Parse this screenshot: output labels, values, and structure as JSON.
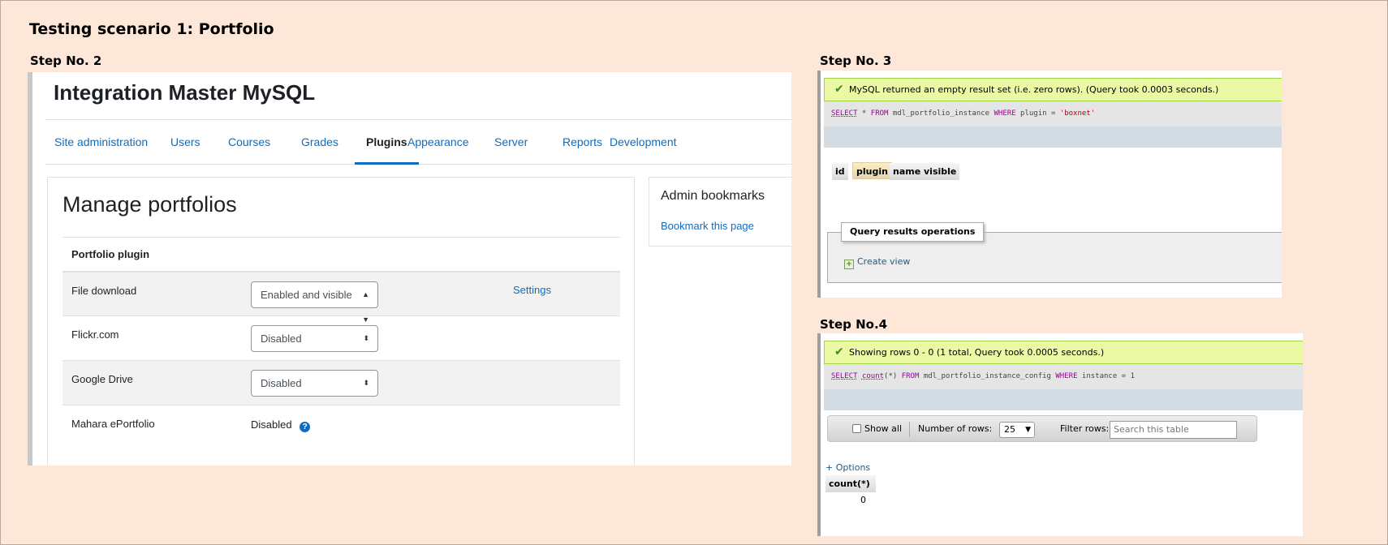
{
  "doc": {
    "title": "Testing scenario 1: Portfolio",
    "step2_label": "Step No. 2",
    "step3_label": "Step No. 3",
    "step4_label": "Step No.4"
  },
  "moodle": {
    "site_title": "Integration Master MySQL",
    "nav": [
      {
        "label": "Site administration",
        "active": false
      },
      {
        "label": "Users",
        "active": false
      },
      {
        "label": "Courses",
        "active": false
      },
      {
        "label": "Grades",
        "active": false
      },
      {
        "label": "Plugins",
        "active": true
      },
      {
        "label": "Appearance",
        "active": false
      },
      {
        "label": "Server",
        "active": false
      },
      {
        "label": "Reports",
        "active": false
      },
      {
        "label": "Development",
        "active": false
      }
    ],
    "heading": "Manage portfolios",
    "table_header": "Portfolio plugin",
    "rows": [
      {
        "name": "File download",
        "state": "Enabled and visible",
        "settings": "Settings"
      },
      {
        "name": "Flickr.com",
        "state": "Disabled"
      },
      {
        "name": "Google Drive",
        "state": "Disabled"
      },
      {
        "name": "Mahara ePortfolio",
        "state_text": "Disabled"
      }
    ],
    "help_icon": "question-circle-icon",
    "bookmarks_title": "Admin bookmarks",
    "bookmark_link": "Bookmark this page",
    "colors": {
      "link": "#0f6cbf",
      "text": "#1d2125"
    }
  },
  "step3": {
    "success_message": "MySQL returned an empty result set (i.e. zero rows). (Query took 0.0003 seconds.)",
    "sql": {
      "select": "SELECT",
      "rest1": " * ",
      "from": "FROM",
      "rest2": " mdl_portfolio_instance ",
      "where": "WHERE",
      "rest3": " plugin = ",
      "value": "'boxnet'"
    },
    "columns": [
      "id",
      "plugin",
      "name",
      "visible"
    ],
    "operations_legend": "Query results operations",
    "create_view": "Create view"
  },
  "step4": {
    "success_message": "Showing rows 0 - 0 (1 total, Query took 0.0005 seconds.)",
    "sql": {
      "select": "SELECT",
      "count": "count",
      "rest1": "(*) ",
      "from": "FROM",
      "rest2": " mdl_portfolio_instance_config ",
      "where": "WHERE",
      "rest3": " instance = 1"
    },
    "show_all": "Show all",
    "num_rows_label": "Number of rows:",
    "num_rows_value": "25",
    "filter_label": "Filter rows:",
    "filter_placeholder": "Search this table",
    "options_link": "+ Options",
    "column": "count(*)",
    "value": "0"
  }
}
